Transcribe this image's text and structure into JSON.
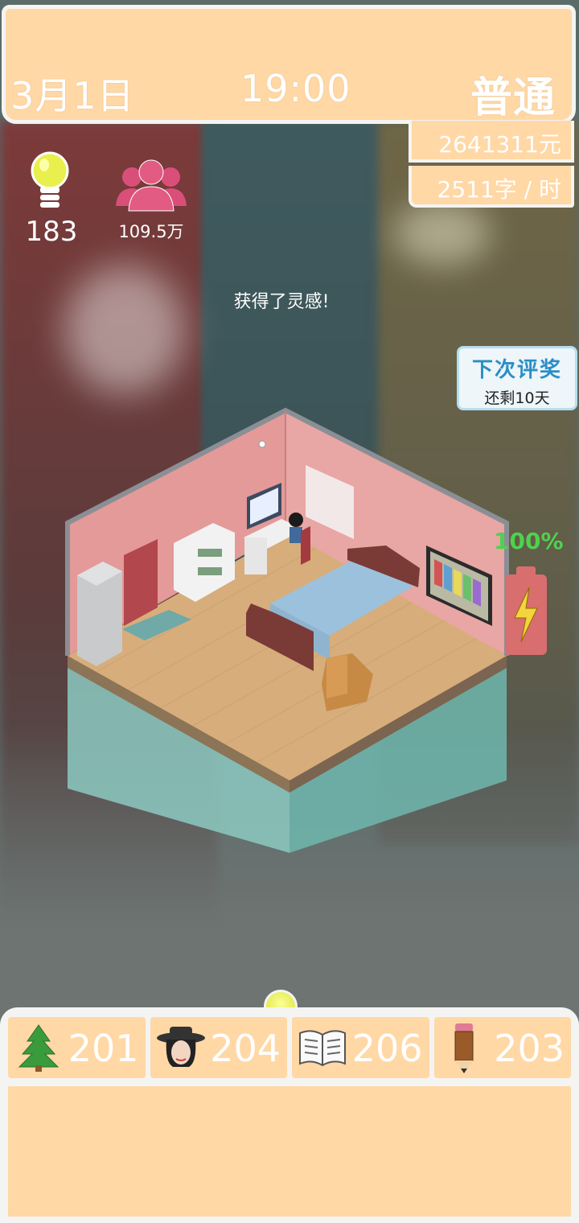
{
  "header": {
    "date": "3月1日",
    "time": "19:00",
    "difficulty": "普通"
  },
  "stats": {
    "money": "2641311元",
    "writing_speed": "2511字 / 时",
    "inspiration": "183",
    "fans": "109.5万"
  },
  "notification": "获得了灵感!",
  "award_countdown": {
    "title": "下次评奖",
    "remaining": "还剩10天"
  },
  "energy": {
    "label": "100%",
    "level": 1.0
  },
  "tabs": [
    {
      "icon": "tree-icon",
      "value": "201"
    },
    {
      "icon": "hat-woman-icon",
      "value": "204"
    },
    {
      "icon": "open-book-icon",
      "value": "206"
    },
    {
      "icon": "pencil-icon",
      "value": "203"
    }
  ],
  "colors": {
    "panel": "#ffd8a6",
    "frame": "#f4f4f2",
    "wall": "#e39a98",
    "floor": "#d7ad7b",
    "battery": "#d96e6e",
    "bolt": "#f4d43c",
    "award_title": "#2a8fc4"
  }
}
